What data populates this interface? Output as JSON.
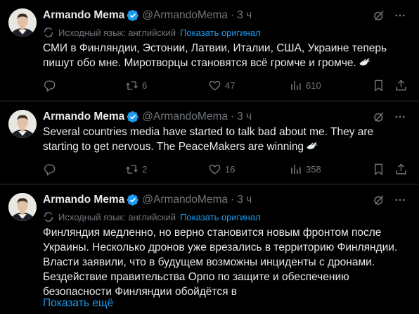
{
  "tweets": [
    {
      "author_name": "Armando Mema",
      "handle": "@ArmandoMema",
      "separator": "·",
      "time": "3 ч",
      "translation_label": "Исходный язык: английский",
      "show_original": "Показать оригинал",
      "text_lines": [
        "СМИ в Финляндии, Эстонии, Латвии, Италии, США, Украине теперь",
        "пишут обо мне. Миротворцы становятся всё громче и громче."
      ],
      "replies": "",
      "reposts": "6",
      "likes": "47",
      "views": "610"
    },
    {
      "author_name": "Armando Mema",
      "handle": "@ArmandoMema",
      "separator": "·",
      "time": "3 ч",
      "text_lines": [
        "Several countries media have started to talk bad about me. They are",
        "starting to get nervous. The PeaceMakers are winning"
      ],
      "replies": "",
      "reposts": "2",
      "likes": "16",
      "views": "358"
    },
    {
      "author_name": "Armando Mema",
      "handle": "@ArmandoMema",
      "separator": "·",
      "time": "3 ч",
      "translation_label": "Исходный язык: английский",
      "show_original": "Показать оригинал",
      "text_lines": [
        "Финляндия медленно, но верно становится новым фронтом после",
        "Украины. Несколько дронов уже врезались в территорию Финляндии.",
        "Власти заявили, что в будущем возможны инциденты с дронами.",
        "Бездействие правительства Орпо по защите и обеспечению",
        "безопасности Финляндии обойдётся в"
      ],
      "show_more": "Показать ещё"
    }
  ],
  "colors": {
    "background": "#000000",
    "text": "#e7e9ea",
    "secondary": "#71767b",
    "accent": "#1d9bf0",
    "divider": "#2f3336"
  },
  "icons": {
    "verified": "verified-badge-icon",
    "grok": "grok-icon",
    "more": "more-icon",
    "translate": "translate-icon",
    "reply": "reply-icon",
    "repost": "repost-icon",
    "like": "like-icon",
    "views": "views-icon",
    "bookmark": "bookmark-icon",
    "share": "share-icon",
    "dove": "dove-emoji-icon"
  }
}
